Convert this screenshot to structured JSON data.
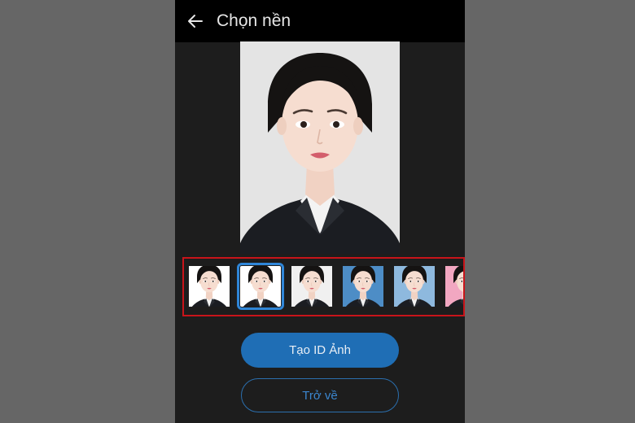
{
  "header": {
    "title": "Chọn nền",
    "back_icon": "arrow-left-icon"
  },
  "preview": {
    "background": "#e4e4e4",
    "image": "portrait-photo"
  },
  "backgrounds": [
    {
      "color": "#ffffff"
    },
    {
      "color": "#ffffff",
      "selected": true
    },
    {
      "color": "#f0f0f0"
    },
    {
      "color": "#4d8dc6"
    },
    {
      "color": "#8eb9de"
    },
    {
      "color": "#f2a7c1"
    }
  ],
  "actions": {
    "create_label": "Tạo ID Ảnh",
    "back_label": "Trở về"
  },
  "colors": {
    "accent": "#1f6eb5",
    "highlight_frame": "#c8141a",
    "selected_outline": "#2f86d8"
  }
}
